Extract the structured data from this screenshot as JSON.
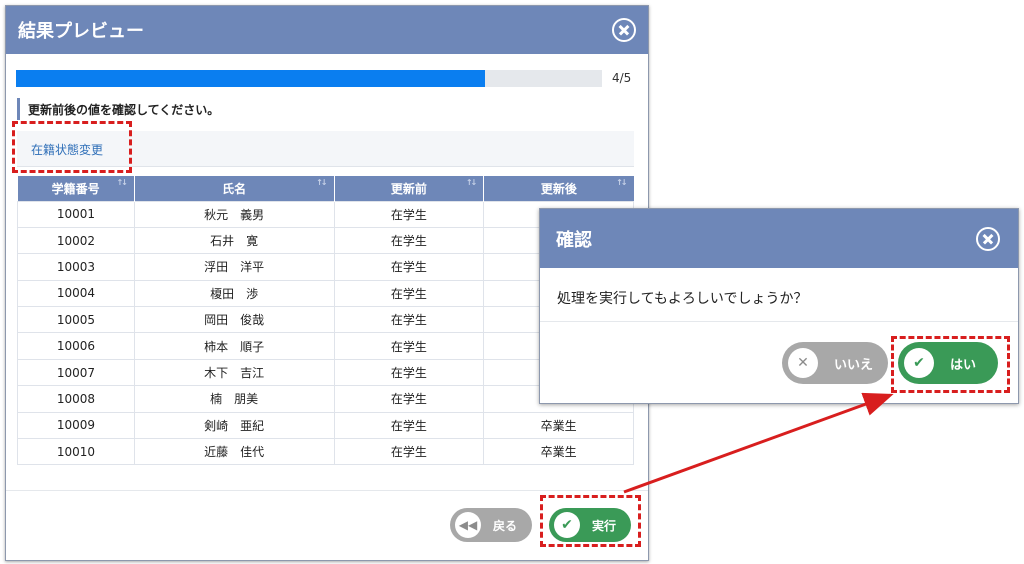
{
  "main_dialog": {
    "title": "結果プレビュー",
    "progress": {
      "current": 4,
      "total": 5,
      "label": "4/5"
    },
    "instruction": "更新前後の値を確認してください。",
    "tab_label": "在籍状態変更",
    "table": {
      "headers": [
        "学籍番号",
        "氏名",
        "更新前",
        "更新後"
      ],
      "rows": [
        [
          "10001",
          "秋元　義男",
          "在学生",
          ""
        ],
        [
          "10002",
          "石井　寛",
          "在学生",
          ""
        ],
        [
          "10003",
          "浮田　洋平",
          "在学生",
          ""
        ],
        [
          "10004",
          "榎田　渉",
          "在学生",
          ""
        ],
        [
          "10005",
          "岡田　俊哉",
          "在学生",
          ""
        ],
        [
          "10006",
          "柿本　順子",
          "在学生",
          ""
        ],
        [
          "10007",
          "木下　吉江",
          "在学生",
          ""
        ],
        [
          "10008",
          "楠　朋美",
          "在学生",
          ""
        ],
        [
          "10009",
          "剣崎　亜紀",
          "在学生",
          "卒業生"
        ],
        [
          "10010",
          "近藤　佳代",
          "在学生",
          "卒業生"
        ]
      ]
    },
    "back_label": "戻る",
    "exec_label": "実行"
  },
  "confirm_dialog": {
    "title": "確認",
    "message": "処理を実行してもよろしいでしょうか？",
    "no_label": "いいえ",
    "yes_label": "はい"
  },
  "colors": {
    "header_bg": "#6e87b8",
    "progress_fill": "#0a7ef0",
    "green": "#3a9a57",
    "gray": "#a8a8a8",
    "annotation_red": "#d81e1e"
  }
}
